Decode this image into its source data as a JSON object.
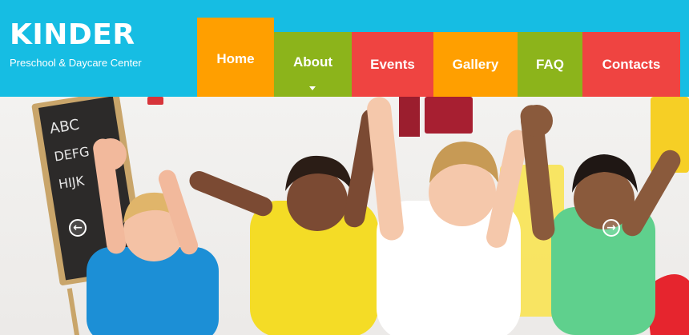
{
  "brand": {
    "title": "KINDER",
    "subtitle": "Preschool & Daycare Center"
  },
  "nav": {
    "items": [
      {
        "label": "Home",
        "color": "#ff9f00",
        "active": true
      },
      {
        "label": "About",
        "color": "#8cb41b",
        "has_dropdown": true
      },
      {
        "label": "Events",
        "color": "#ef4441"
      },
      {
        "label": "Gallery",
        "color": "#ff9f00"
      },
      {
        "label": "FAQ",
        "color": "#8cb41b"
      },
      {
        "label": "Contacts",
        "color": "#ef4441"
      }
    ]
  },
  "colors": {
    "header_bg": "#16bde3",
    "orange": "#ff9f00",
    "green": "#8cb41b",
    "red": "#ef4441"
  },
  "slider": {
    "prev_icon": "arrow-left-circle-icon",
    "next_icon": "arrow-right-circle-icon",
    "prev_glyph": "←",
    "next_glyph": "→"
  }
}
